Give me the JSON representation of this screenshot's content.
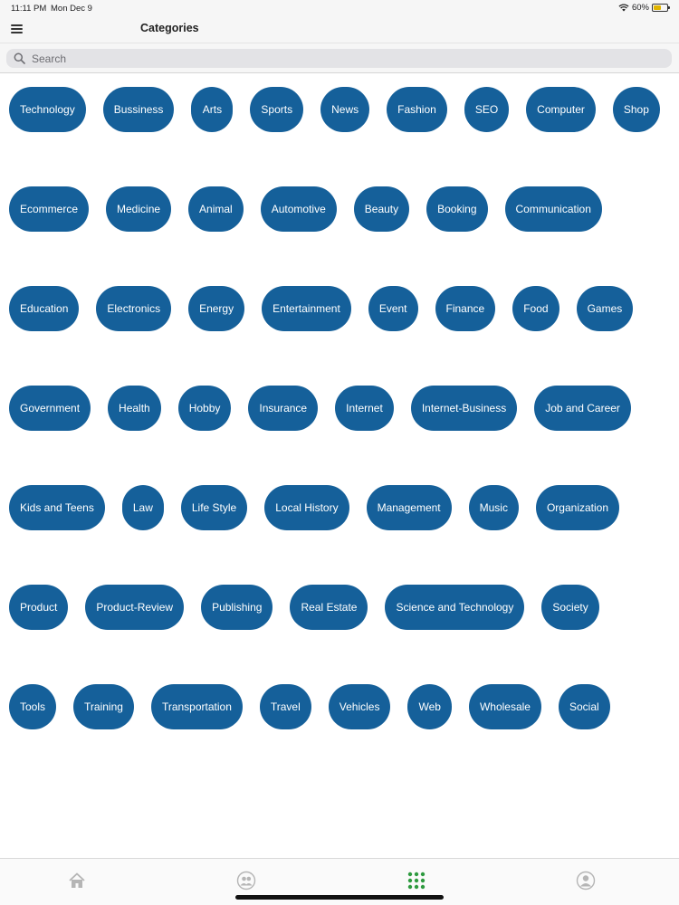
{
  "status": {
    "time": "11:11 PM",
    "date": "Mon Dec 9",
    "battery": "60%",
    "battery_level": 0.6
  },
  "header": {
    "title": "Categories",
    "menu_icon": "hamburger-menu-icon"
  },
  "search": {
    "placeholder": "Search",
    "value": "",
    "icon": "magnifier-icon"
  },
  "categories": [
    [
      "Technology",
      "Bussiness",
      "Arts",
      "Sports",
      "News",
      "Fashion",
      "SEO",
      "Computer",
      "Shop"
    ],
    [
      "Ecommerce",
      "Medicine",
      "Animal",
      "Automotive",
      "Beauty",
      "Booking",
      "Communication"
    ],
    [
      "Education",
      "Electronics",
      "Energy",
      "Entertainment",
      "Event",
      "Finance",
      "Food",
      "Games"
    ],
    [
      "Government",
      "Health",
      "Hobby",
      "Insurance",
      "Internet",
      "Internet-Business",
      "Job and Career"
    ],
    [
      "Kids and Teens",
      "Law",
      "Life Style",
      "Local History",
      "Management",
      "Music",
      "Organization"
    ],
    [
      "Product",
      "Product-Review",
      "Publishing",
      "Real Estate",
      "Science and Technology",
      "Society"
    ],
    [
      "Tools",
      "Training",
      "Transportation",
      "Travel",
      "Vehicles",
      "Web",
      "Wholesale",
      "Social"
    ]
  ],
  "tabs": [
    {
      "icon": "home-icon",
      "active": false
    },
    {
      "icon": "users-icon",
      "active": false
    },
    {
      "icon": "grid-icon",
      "active": true
    },
    {
      "icon": "profile-icon",
      "active": false
    }
  ],
  "colors": {
    "chip_background": "#15609a",
    "chip_text": "#ffffff",
    "tab_active": "#2e9a3f",
    "tab_inactive": "#b5b5b5"
  }
}
